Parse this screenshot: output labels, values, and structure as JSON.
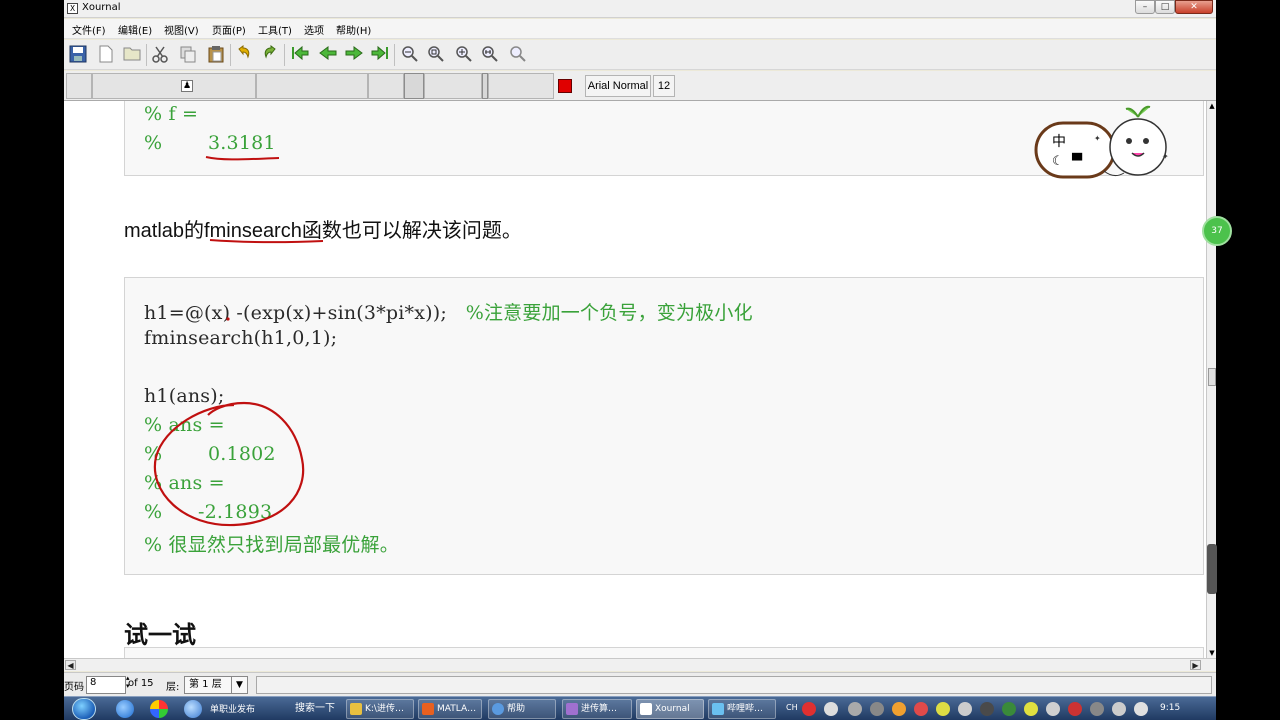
{
  "window": {
    "title": "Xournal",
    "icon_letter": "X"
  },
  "menu": [
    "文件(F)",
    "编辑(E)",
    "视图(V)",
    "页面(P)",
    "工具(T)",
    "选项",
    "帮助(H)"
  ],
  "toolbar2": {
    "font_name": "Arial Normal",
    "font_size": "12",
    "color": "#e00000"
  },
  "document": {
    "top_block": {
      "line1": "% f =",
      "line2_prefix": "%",
      "line2_value": "3.3181"
    },
    "prose_prefix": "matlab的",
    "prose_func": "fminsearch",
    "prose_suffix": "函数也可以解决该问题。",
    "code_block": {
      "line1_code": "h1=@(x) -(exp(x)+sin(3*pi*x));",
      "line1_comment": "%注意要加一个负号，变为极小化",
      "line2": "fminsearch(h1,0,1);",
      "line3": "h1(ans);",
      "line4": "% ans =",
      "line5_prefix": "%",
      "line5_value": "0.1802",
      "line6": "% ans =",
      "line7_prefix": "%",
      "line7_value": "-2.1893",
      "line8": "% 很显然只找到局部最优解。"
    },
    "heading": "试一试",
    "badge_text": "中",
    "side_badge": "37"
  },
  "status": {
    "page_label": "页码",
    "page_value": "8",
    "of_pages": "of 15",
    "layer_label": "层:",
    "layer_value": "第 1 层"
  },
  "taskbar": {
    "desk_label": "单职业发布",
    "search_label": "搜索一下",
    "tasks": [
      "K:\\进传…",
      "MATLA…",
      "帮助",
      "进传算…",
      "Xournal",
      "哔哩哔…"
    ],
    "ime": "CH",
    "clock": "9:15"
  }
}
